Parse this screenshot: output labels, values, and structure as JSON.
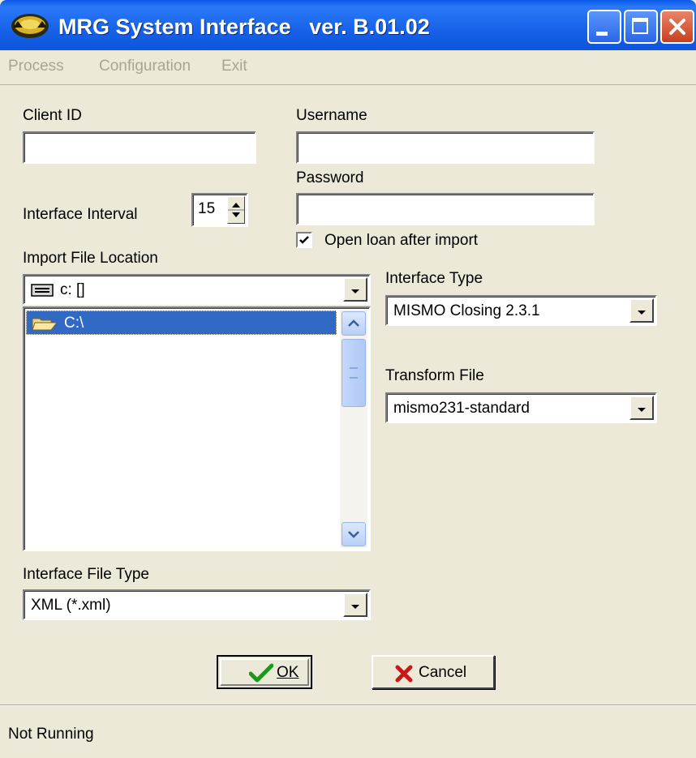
{
  "window": {
    "title": "MRG System Interface   ver. B.01.02"
  },
  "menu": {
    "items": [
      "Process",
      "Configuration",
      "Exit"
    ]
  },
  "fields": {
    "client_id_label": "Client ID",
    "client_id_value": "",
    "username_label": "Username",
    "username_value": "",
    "password_label": "Password",
    "password_value": "",
    "interval_label": "Interface Interval",
    "interval_value": "15",
    "open_loan_label": "Open loan after import",
    "open_loan_checked": true
  },
  "import": {
    "location_label": "Import File Location",
    "drive_value": "c: []",
    "folder_items": [
      "C:\\"
    ]
  },
  "interface_file_type": {
    "label": "Interface File Type",
    "value": "XML (*.xml)"
  },
  "interface_type": {
    "label": "Interface Type",
    "value": "MISMO Closing 2.3.1"
  },
  "transform_file": {
    "label": "Transform File",
    "value": "mismo231-standard"
  },
  "buttons": {
    "ok": "OK",
    "cancel": "Cancel"
  },
  "status": {
    "text": "Not Running"
  },
  "icons": [
    "app-icon",
    "minimize-icon",
    "maximize-icon",
    "close-icon",
    "drive-icon",
    "folder-open-icon",
    "checkmark-icon",
    "cancel-x-icon",
    "chevron-down-icon",
    "chevron-up-icon"
  ]
}
